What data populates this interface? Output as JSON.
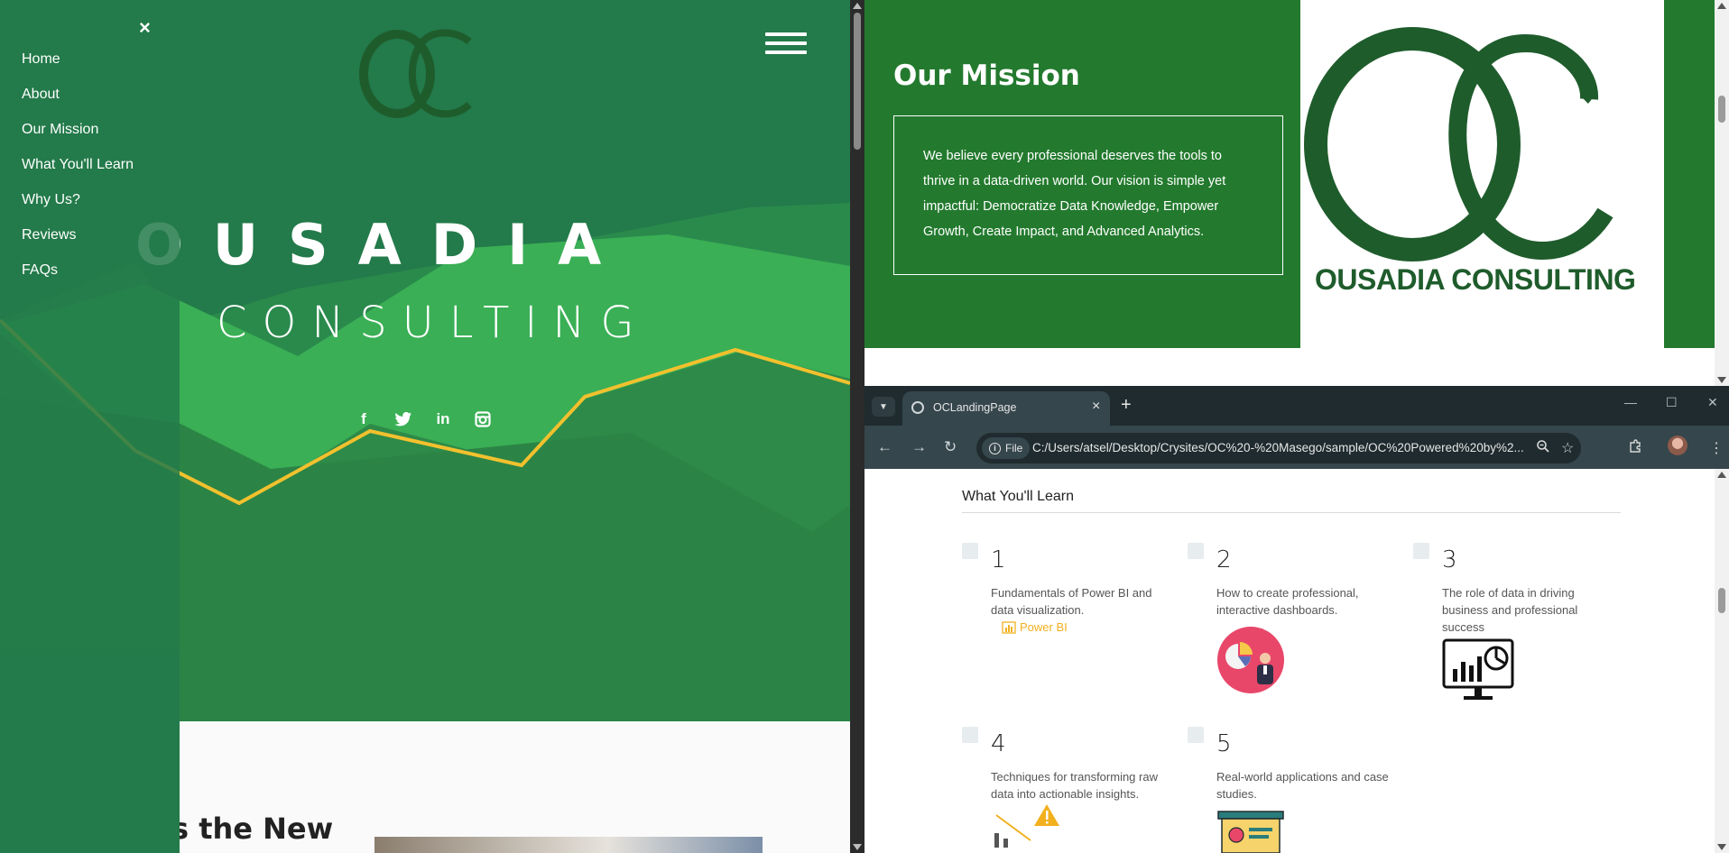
{
  "left_window": {
    "side_menu": {
      "close_glyph": "×",
      "items": [
        "Home",
        "About",
        "Our Mission",
        "What You'll Learn",
        "Why Us?",
        "Reviews",
        "FAQs"
      ]
    },
    "hero": {
      "logo_letters": "OC",
      "brand_line1": "OUSADIA",
      "brand_line2": "CONSULTING",
      "social_icons": [
        "facebook-icon",
        "twitter-icon",
        "linkedin-icon",
        "instagram-icon"
      ],
      "social_glyphs": {
        "facebook": "f",
        "twitter": "t",
        "linkedin": "in",
        "instagram": "◎"
      }
    },
    "partial_section_heading": "s the New",
    "colors": {
      "hero_green": "#237a4a",
      "light_green": "#3aaf55",
      "line_yellow": "#f2c12e"
    }
  },
  "top_right_window": {
    "mission_title": "Our Mission",
    "mission_text": "We believe every professional deserves the tools to thrive in a data-driven world. Our vision is simple yet impactful: Democratize Data Knowledge, Empower Growth, Create Impact, and Advanced Analytics.",
    "logo_caption": "OUSADIA CONSULTING",
    "colors": {
      "mission_green": "#237a2e",
      "logo_green": "#1f5c2c"
    }
  },
  "browser": {
    "tab_title": "OCLandingPage",
    "new_tab_glyph": "+",
    "site_info_label": "File",
    "url": "C:/Users/atsel/Desktop/Crysites/OC%20-%20Masego/sample/OC%20Powered%20by%2...",
    "window_controls": {
      "minimize": "—",
      "maximize": "☐",
      "close": "✕"
    },
    "nav": {
      "back": "←",
      "forward": "→",
      "reload": "↻"
    },
    "page": {
      "section_title": "What You'll Learn",
      "items": [
        {
          "number": "1",
          "text": "Fundamentals of Power BI and data visualization.",
          "tag": "Power BI"
        },
        {
          "number": "2",
          "text": "How to create professional, interactive dashboards."
        },
        {
          "number": "3",
          "text": "The role of data in driving business and professional success"
        },
        {
          "number": "4",
          "text": "Techniques for transforming raw data into actionable insights."
        },
        {
          "number": "5",
          "text": "Real-world applications and case studies."
        }
      ]
    }
  }
}
